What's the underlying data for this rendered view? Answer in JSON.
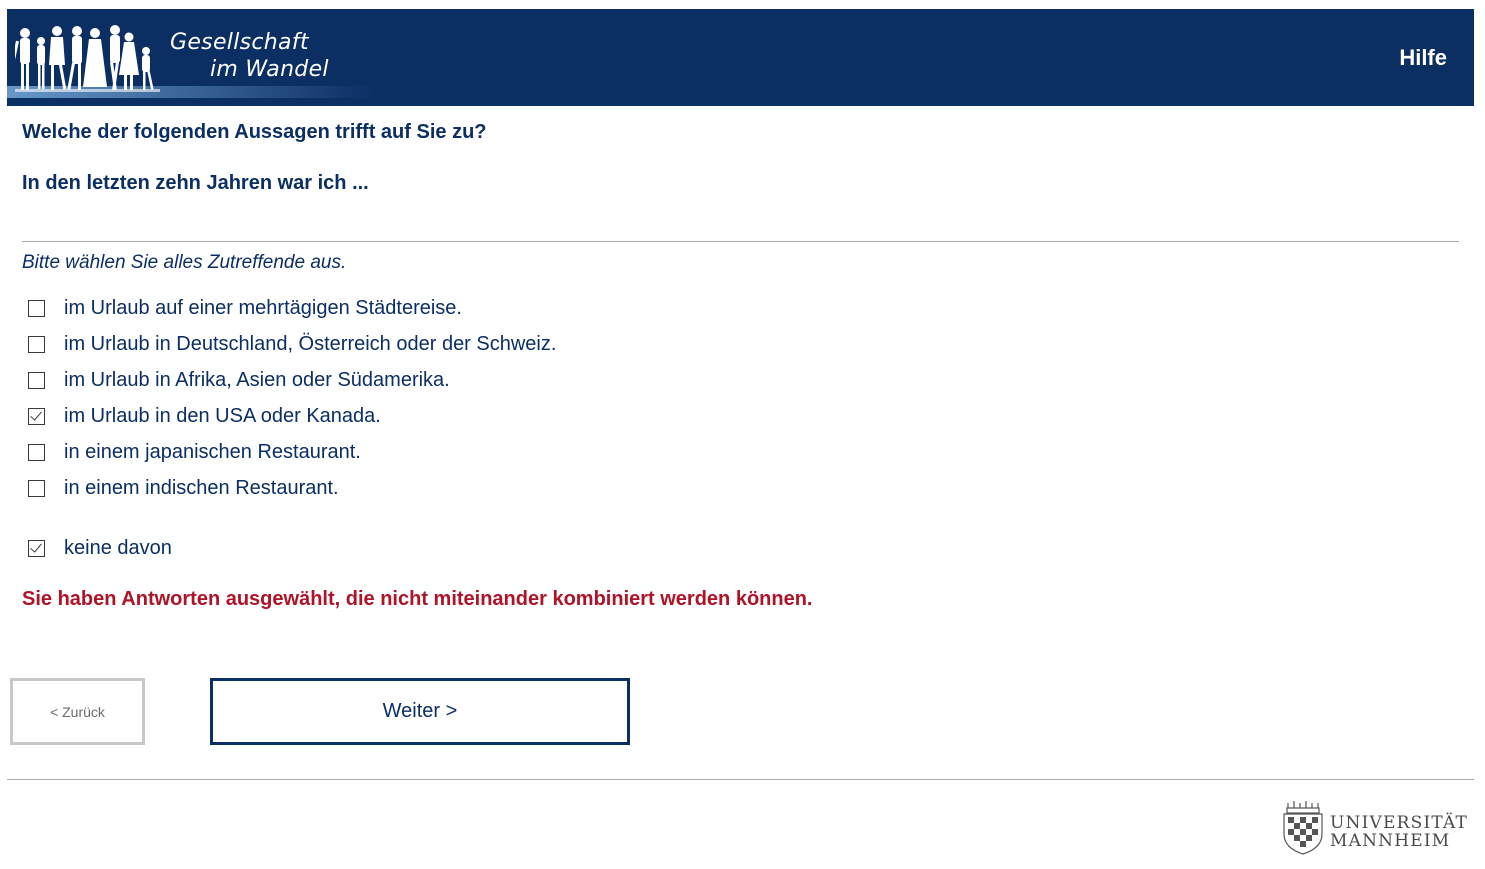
{
  "header": {
    "logo_line1": "Gesellschaft",
    "logo_line2": "im Wandel",
    "help_label": "Hilfe",
    "background_color": "#0b2e63"
  },
  "question": {
    "title": "Welche der folgenden Aussagen trifft auf Sie zu?",
    "subtitle": "In den letzten zehn Jahren war ich ...",
    "instruction": "Bitte wählen Sie alles Zutreffende aus."
  },
  "options": [
    {
      "label": "im Urlaub auf einer mehrtägigen Städtereise.",
      "checked": false
    },
    {
      "label": "im Urlaub in Deutschland, Österreich oder der Schweiz.",
      "checked": false
    },
    {
      "label": "im Urlaub in Afrika, Asien oder Südamerika.",
      "checked": false
    },
    {
      "label": "im Urlaub in den USA oder Kanada.",
      "checked": true
    },
    {
      "label": "in einem japanischen Restaurant.",
      "checked": false
    },
    {
      "label": "in einem indischen Restaurant.",
      "checked": false
    }
  ],
  "exclusive_option": {
    "label": "keine davon",
    "checked": true
  },
  "error": {
    "message": "Sie haben Antworten ausgewählt, die nicht miteinander kombiniert werden können.",
    "color": "#b01228"
  },
  "navigation": {
    "back_label": "< Zurück",
    "next_label": "Weiter >"
  },
  "footer": {
    "university_line1": "UNIVERSITÄT",
    "university_line2": "MANNHEIM"
  }
}
